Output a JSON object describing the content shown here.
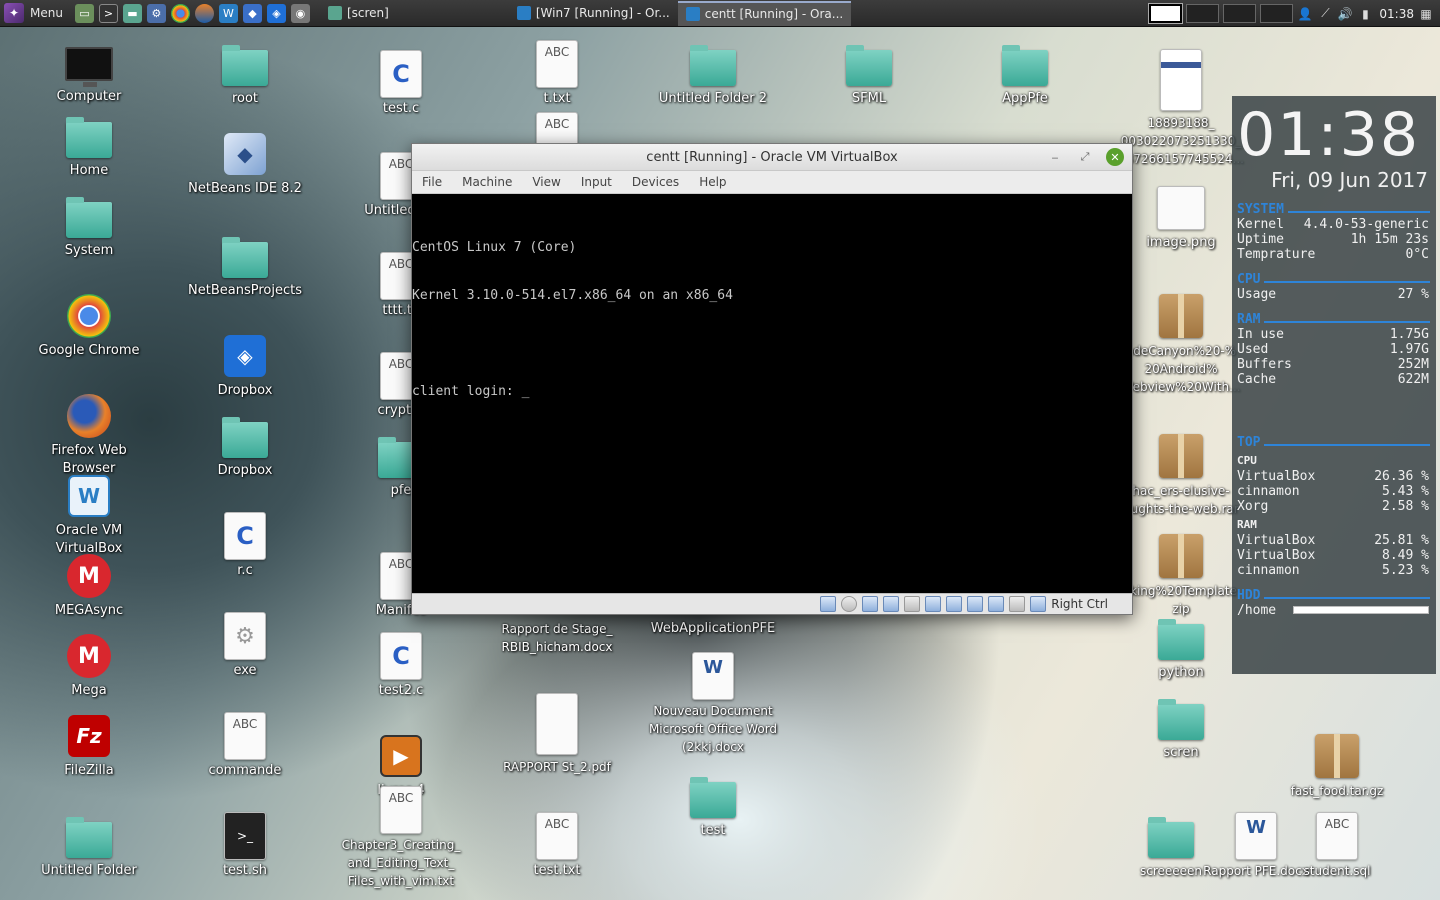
{
  "taskbar": {
    "menu_label": "Menu",
    "tasks": [
      {
        "label": "[scren]"
      },
      {
        "label": "[Win7 [Running] - Or..."
      },
      {
        "label": "centt [Running] - Ora..."
      }
    ],
    "clock": "01:38"
  },
  "desktop_icons": {
    "computer": "Computer",
    "home": "Home",
    "system": "System",
    "chrome": "Google Chrome",
    "firefox": "Firefox Web Browser",
    "vbox": "Oracle VM VirtualBox",
    "megasync": "MEGAsync",
    "mega": "Mega",
    "filezilla": "FileZilla",
    "untitled_folder": "Untitled Folder",
    "root": "root",
    "netbeans": "NetBeans IDE 8.2",
    "netbeans_projects": "NetBeansProjects",
    "dropbox_app": "Dropbox",
    "dropbox_folder": "Dropbox",
    "rc": "r.c",
    "exe": "exe",
    "commande": "commande",
    "testsh": "test.sh",
    "testc": "test.c",
    "untitled_doc": "Untitled Do",
    "tttt": "tttt.tx",
    "crypter": "crypter",
    "pfe": "pfe",
    "manifest": "Manifes",
    "test2c": "test2.c",
    "livres": "livres.4",
    "chapter3": "Chapter3_Creating_ and_Editing_Text_ Files_with_vim.txt",
    "ttxt": "t.txt",
    "rapport_stage": "Rapport de Stage_ RBIB_hicham.docx",
    "rapport_st2": "RAPPORT St_2.pdf",
    "testtxt": "test.txt",
    "untitled_folder2": "Untitled Folder 2",
    "webapp": "WebApplicationPFE",
    "nouveau_doc": "Nouveau Document Microsoft Office Word (2kkj.docx",
    "test_folder": "test",
    "sfml": "SFML",
    "appfe": "AppPfe",
    "screenshot_file": "18893188_ 003022073251330_ 587266157745524...",
    "image_png": "image.png",
    "codecanyon": "odeCanyon%20-% 20Android% Webview%20With...",
    "hackers": "hac_ers-elusive- oughts-the-web.rar",
    "working": "rking%20Template zip",
    "python": "python",
    "scren": "scren",
    "fast_food": "fast_food.tar.gz",
    "screeeeen": "screeeeen",
    "rapport_pfe": "Rapport PFE.docx",
    "student_sql": "student.sql"
  },
  "vbox": {
    "title": "centt [Running] - Oracle VM VirtualBox",
    "menu": [
      "File",
      "Machine",
      "View",
      "Input",
      "Devices",
      "Help"
    ],
    "console": {
      "line1": "CentOS Linux 7 (Core)",
      "line2": "Kernel 3.10.0-514.el7.x86_64 on an x86_64",
      "line3": "client login: _"
    },
    "host_key": "Right Ctrl"
  },
  "conky": {
    "time": "01:38",
    "date": "Fri, 09 Jun 2017",
    "system": {
      "title": "SYSTEM",
      "kernel_label": "Kernel",
      "kernel": "4.4.0-53-generic",
      "uptime_label": "Uptime",
      "uptime": "1h 15m 23s",
      "temp_label": "Temprature",
      "temp": "0°C"
    },
    "cpu": {
      "title": "CPU",
      "usage_label": "Usage",
      "usage": "27 %"
    },
    "ram": {
      "title": "RAM",
      "rows": [
        {
          "k": "In use",
          "v": "1.75G"
        },
        {
          "k": "Used",
          "v": "1.97G"
        },
        {
          "k": "Buffers",
          "v": "252M"
        },
        {
          "k": "Cache",
          "v": "622M"
        }
      ]
    },
    "top": {
      "title": "TOP",
      "cpu_sub": "CPU",
      "cpu_rows": [
        {
          "k": "VirtualBox",
          "v": "26.36 %"
        },
        {
          "k": "cinnamon",
          "v": "5.43 %"
        },
        {
          "k": "Xorg",
          "v": "2.58 %"
        }
      ],
      "ram_sub": "RAM",
      "ram_rows": [
        {
          "k": "VirtualBox",
          "v": "25.81 %"
        },
        {
          "k": "VirtualBox",
          "v": "8.49 %"
        },
        {
          "k": "cinnamon",
          "v": "5.23 %"
        }
      ]
    },
    "hdd": {
      "title": "HDD",
      "mount": "/home",
      "used_fraction": 0.98
    }
  }
}
